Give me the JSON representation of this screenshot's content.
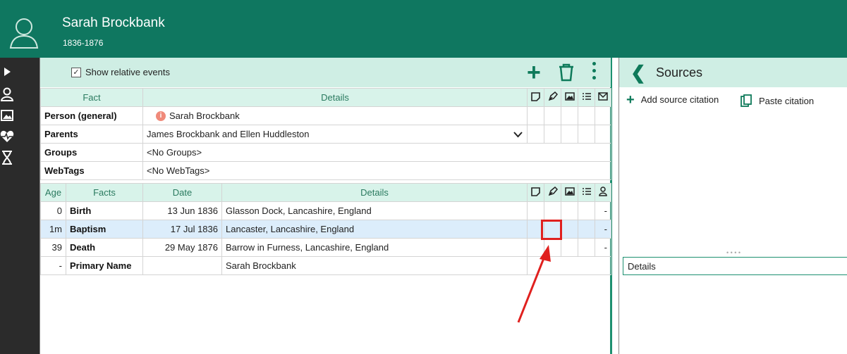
{
  "header": {
    "name": "Sarah Brockbank",
    "dates": "1836-1876"
  },
  "toolbar": {
    "show_relative_events_label": "Show relative events"
  },
  "facts_table": {
    "headers": {
      "fact": "Fact",
      "details": "Details"
    },
    "rows": [
      {
        "fact": "Person (general)",
        "details": "Sarah Brockbank"
      },
      {
        "fact": "Parents",
        "details": "James Brockbank and Ellen Huddleston"
      },
      {
        "fact": "Groups",
        "details": "<No Groups>"
      },
      {
        "fact": "WebTags",
        "details": "<No WebTags>"
      }
    ]
  },
  "events_table": {
    "headers": {
      "age": "Age",
      "facts": "Facts",
      "date": "Date",
      "details": "Details"
    },
    "rows": [
      {
        "age": "0",
        "fact": "Birth",
        "date": "13 Jun 1836",
        "details": "Glasson Dock, Lancashire, England",
        "flag": "-"
      },
      {
        "age": "1m",
        "fact": "Baptism",
        "date": "17 Jul 1836",
        "details": "Lancaster, Lancashire, England",
        "flag": "-"
      },
      {
        "age": "39",
        "fact": "Death",
        "date": "29 May 1876",
        "details": "Barrow in Furness, Lancashire, England",
        "flag": "-"
      },
      {
        "age": "-",
        "fact": "Primary Name",
        "date": "",
        "details": "Sarah Brockbank",
        "flag": ""
      }
    ]
  },
  "sources_panel": {
    "title": "Sources",
    "add_citation": "Add source citation",
    "paste_citation": "Paste citation",
    "details_label": "Details"
  },
  "colors": {
    "header_bg": "#0f7760",
    "accent": "#0e7a5a",
    "highlight": "#e0201e"
  }
}
